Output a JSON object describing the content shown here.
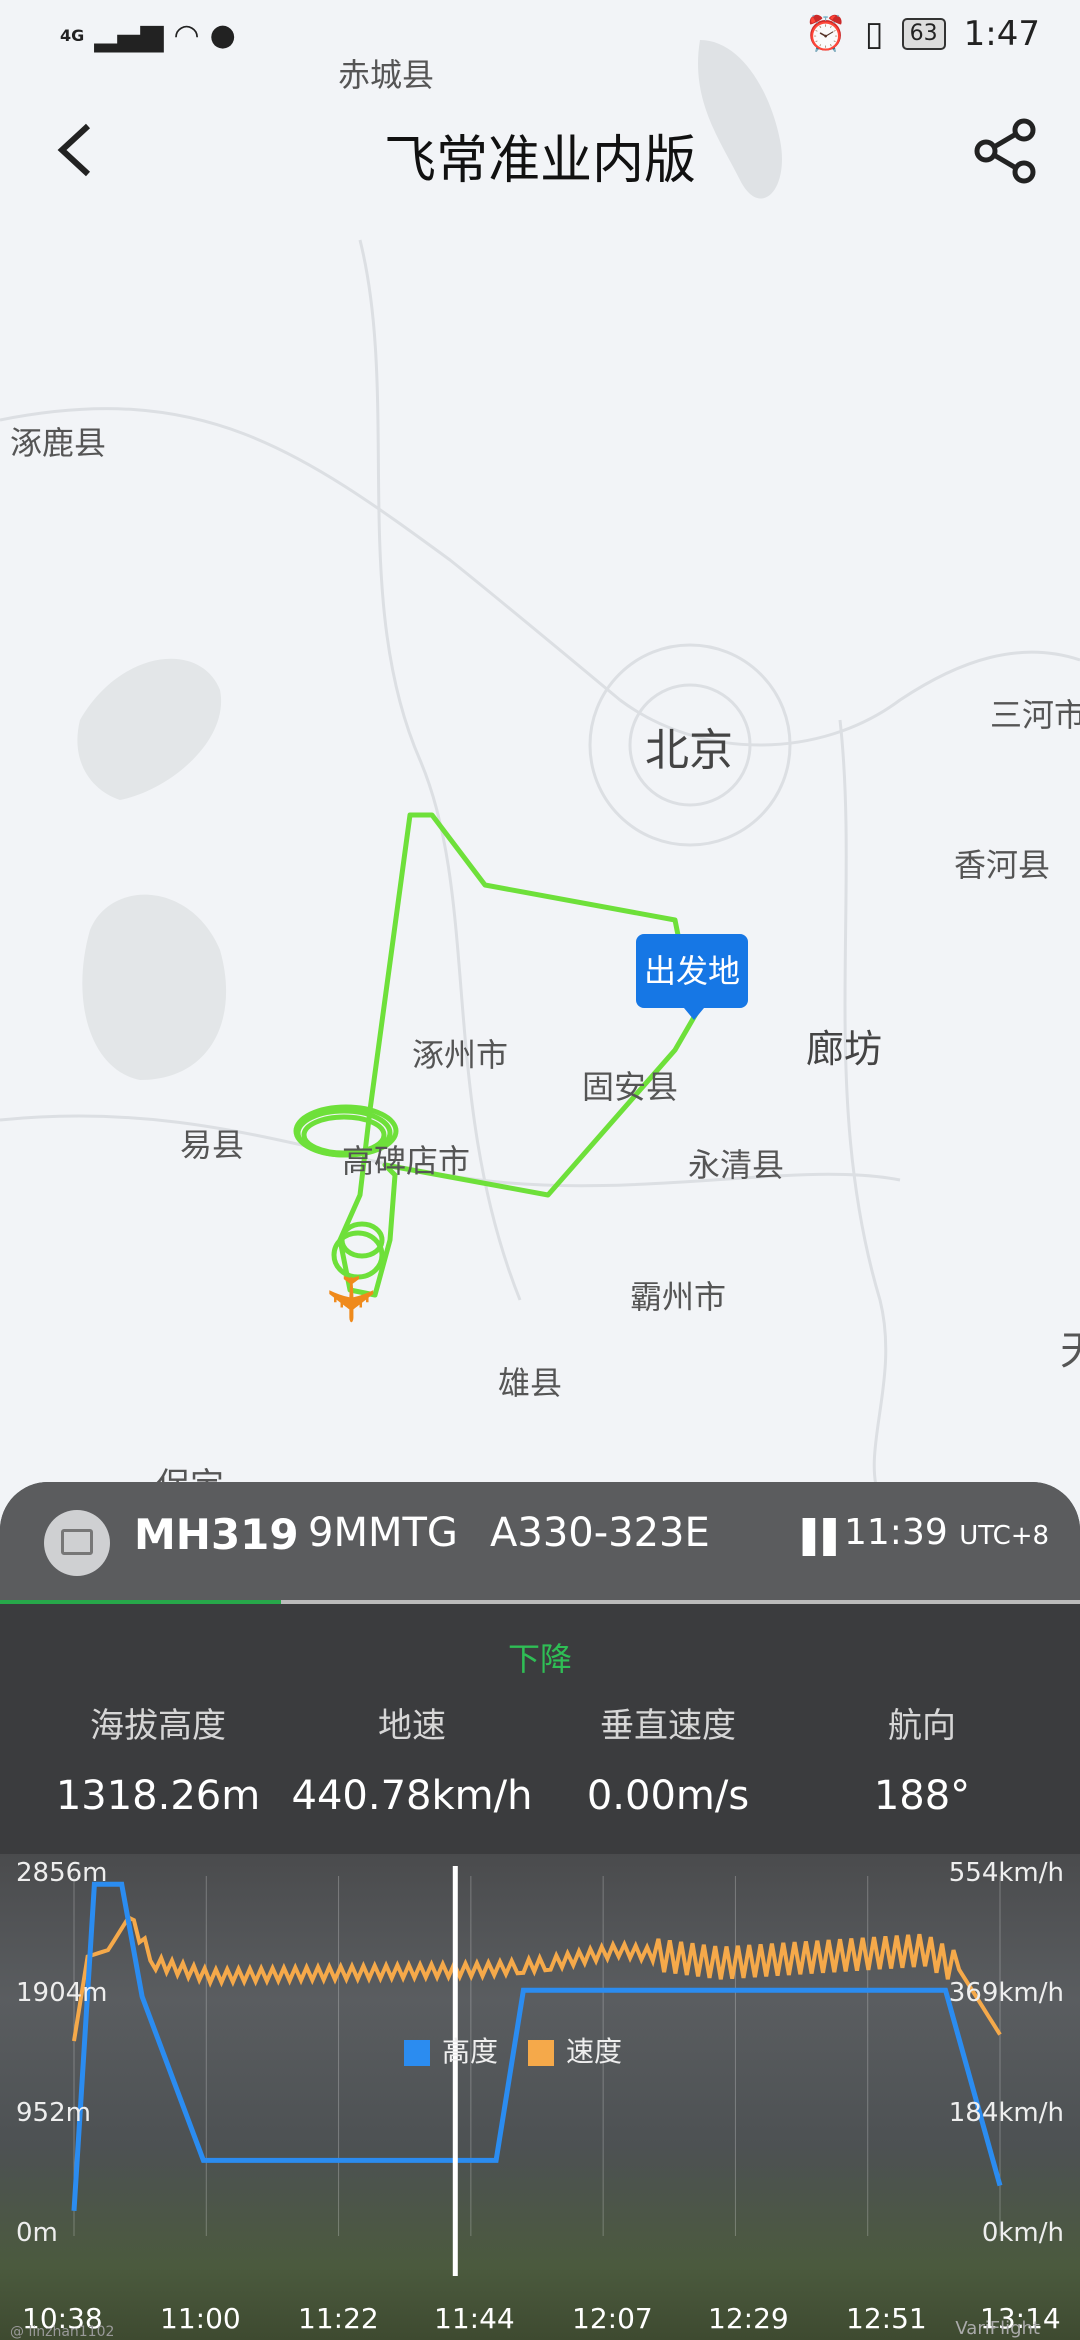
{
  "status_bar": {
    "network": "4G",
    "battery": "63",
    "time": "1:47"
  },
  "header": {
    "title": "飞常准业内版"
  },
  "map": {
    "labels": [
      {
        "id": "chicheng",
        "text": "赤城县"
      },
      {
        "id": "zhuolu",
        "text": "涿鹿县"
      },
      {
        "id": "beijing",
        "text": "北京"
      },
      {
        "id": "sanhe",
        "text": "三河市"
      },
      {
        "id": "xianghe",
        "text": "香河县"
      },
      {
        "id": "langfang",
        "text": "廊坊"
      },
      {
        "id": "zhuozhou",
        "text": "涿州市"
      },
      {
        "id": "guan",
        "text": "固安县"
      },
      {
        "id": "yixian",
        "text": "易县"
      },
      {
        "id": "gaobeidian",
        "text": "高碑店市"
      },
      {
        "id": "yongqing",
        "text": "永清县"
      },
      {
        "id": "bazhou",
        "text": "霸州市"
      },
      {
        "id": "xiongxian",
        "text": "雄县"
      },
      {
        "id": "baoding",
        "text": "保定"
      },
      {
        "id": "tian",
        "text": "天"
      }
    ],
    "departure_pin": "出发地",
    "route_color": "#6ee03a"
  },
  "flight": {
    "flight_no": "MH319",
    "registration": "9MMTG",
    "aircraft": "A330-323E",
    "pause_icon": "pause-icon",
    "time": "11:39",
    "timezone": "UTC+8",
    "progress": 0.26,
    "phase": "下降"
  },
  "stats": [
    {
      "label": "海拔高度",
      "value": "1318.26m"
    },
    {
      "label": "地速",
      "value": "440.78km/h"
    },
    {
      "label": "垂直速度",
      "value": "0.00m/s"
    },
    {
      "label": "航向",
      "value": "188°"
    }
  ],
  "chart_data": {
    "type": "line",
    "x": [
      "10:38",
      "11:00",
      "11:22",
      "11:44",
      "12:07",
      "12:29",
      "12:51",
      "13:14"
    ],
    "left_axis": {
      "ticks": [
        "2856m",
        "1904m",
        "952m",
        "0m"
      ],
      "ylim": [
        0,
        2856
      ]
    },
    "right_axis": {
      "ticks": [
        "554km/h",
        "369km/h",
        "184km/h",
        "0km/h"
      ],
      "ylim": [
        0,
        554
      ]
    },
    "series": [
      {
        "name": "高度",
        "color": "#2b8cf0",
        "points": [
          [
            0,
            200
          ],
          [
            3,
            2790
          ],
          [
            7,
            2790
          ],
          [
            10,
            1900
          ],
          [
            19,
            600
          ],
          [
            45,
            600
          ],
          [
            62,
            600
          ],
          [
            66,
            1950
          ],
          [
            70,
            1950
          ],
          [
            120,
            1950
          ],
          [
            128,
            1950
          ],
          [
            136,
            400
          ]
        ]
      },
      {
        "name": "速度",
        "color": "#f5a94a",
        "points": [
          [
            0,
            300
          ],
          [
            2,
            430
          ],
          [
            5,
            440
          ],
          [
            8,
            490
          ],
          [
            12,
            420
          ],
          [
            20,
            400
          ],
          [
            40,
            405
          ],
          [
            60,
            410
          ],
          [
            66,
            415
          ],
          [
            70,
            420
          ],
          [
            80,
            440
          ],
          [
            95,
            420
          ],
          [
            110,
            430
          ],
          [
            125,
            440
          ],
          [
            130,
            410
          ],
          [
            136,
            310
          ]
        ]
      }
    ],
    "cursor_x": 56,
    "x_max": 136,
    "x_ticks_minutes": [
      0,
      22,
      44,
      66,
      89,
      111,
      133,
      156
    ]
  },
  "watermark": "@ linzhan1102",
  "brand": "VariFlight"
}
